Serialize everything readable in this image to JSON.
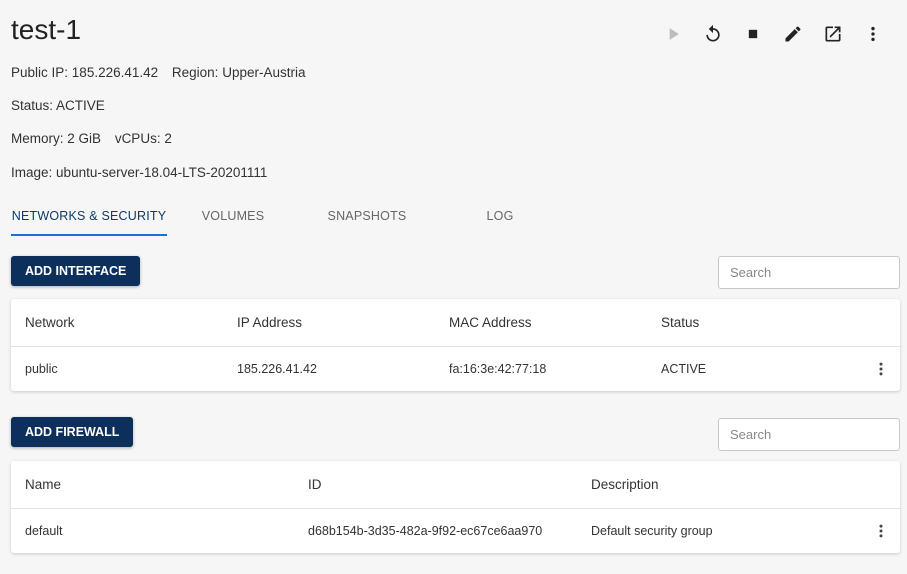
{
  "instance": {
    "name": "test-1",
    "public_ip_label": "Public IP:",
    "public_ip": "185.226.41.42",
    "region_label": "Region:",
    "region": "Upper-Austria",
    "status_label": "Status:",
    "status": "ACTIVE",
    "memory_label": "Memory:",
    "memory": "2 GiB",
    "vcpus_label": "vCPUs:",
    "vcpus": "2",
    "image_label": "Image:",
    "image": "ubuntu-server-18.04-LTS-20201111"
  },
  "toolbar": {
    "icons": [
      "play-icon",
      "restart-icon",
      "stop-icon",
      "edit-icon",
      "open-external-icon",
      "more-vert-icon"
    ]
  },
  "tabs": [
    {
      "label": "NETWORKS & SECURITY",
      "active": true
    },
    {
      "label": "VOLUMES",
      "active": false
    },
    {
      "label": "SNAPSHOTS",
      "active": false
    },
    {
      "label": "LOG",
      "active": false
    }
  ],
  "interfaces": {
    "add_label": "ADD INTERFACE",
    "search_placeholder": "Search",
    "columns": [
      "Network",
      "IP Address",
      "MAC Address",
      "Status"
    ],
    "rows": [
      {
        "network": "public",
        "ip": "185.226.41.42",
        "mac": "fa:16:3e:42:77:18",
        "status": "ACTIVE"
      }
    ]
  },
  "firewalls": {
    "add_label": "ADD FIREWALL",
    "search_placeholder": "Search",
    "columns": [
      "Name",
      "ID",
      "Description"
    ],
    "rows": [
      {
        "name": "default",
        "id": "d68b154b-3d35-482a-9f92-ec67ce6aa970",
        "description": "Default security group"
      }
    ]
  },
  "colors": {
    "primary": "#0c2f5b",
    "tab_indicator": "#1f6fd1"
  }
}
